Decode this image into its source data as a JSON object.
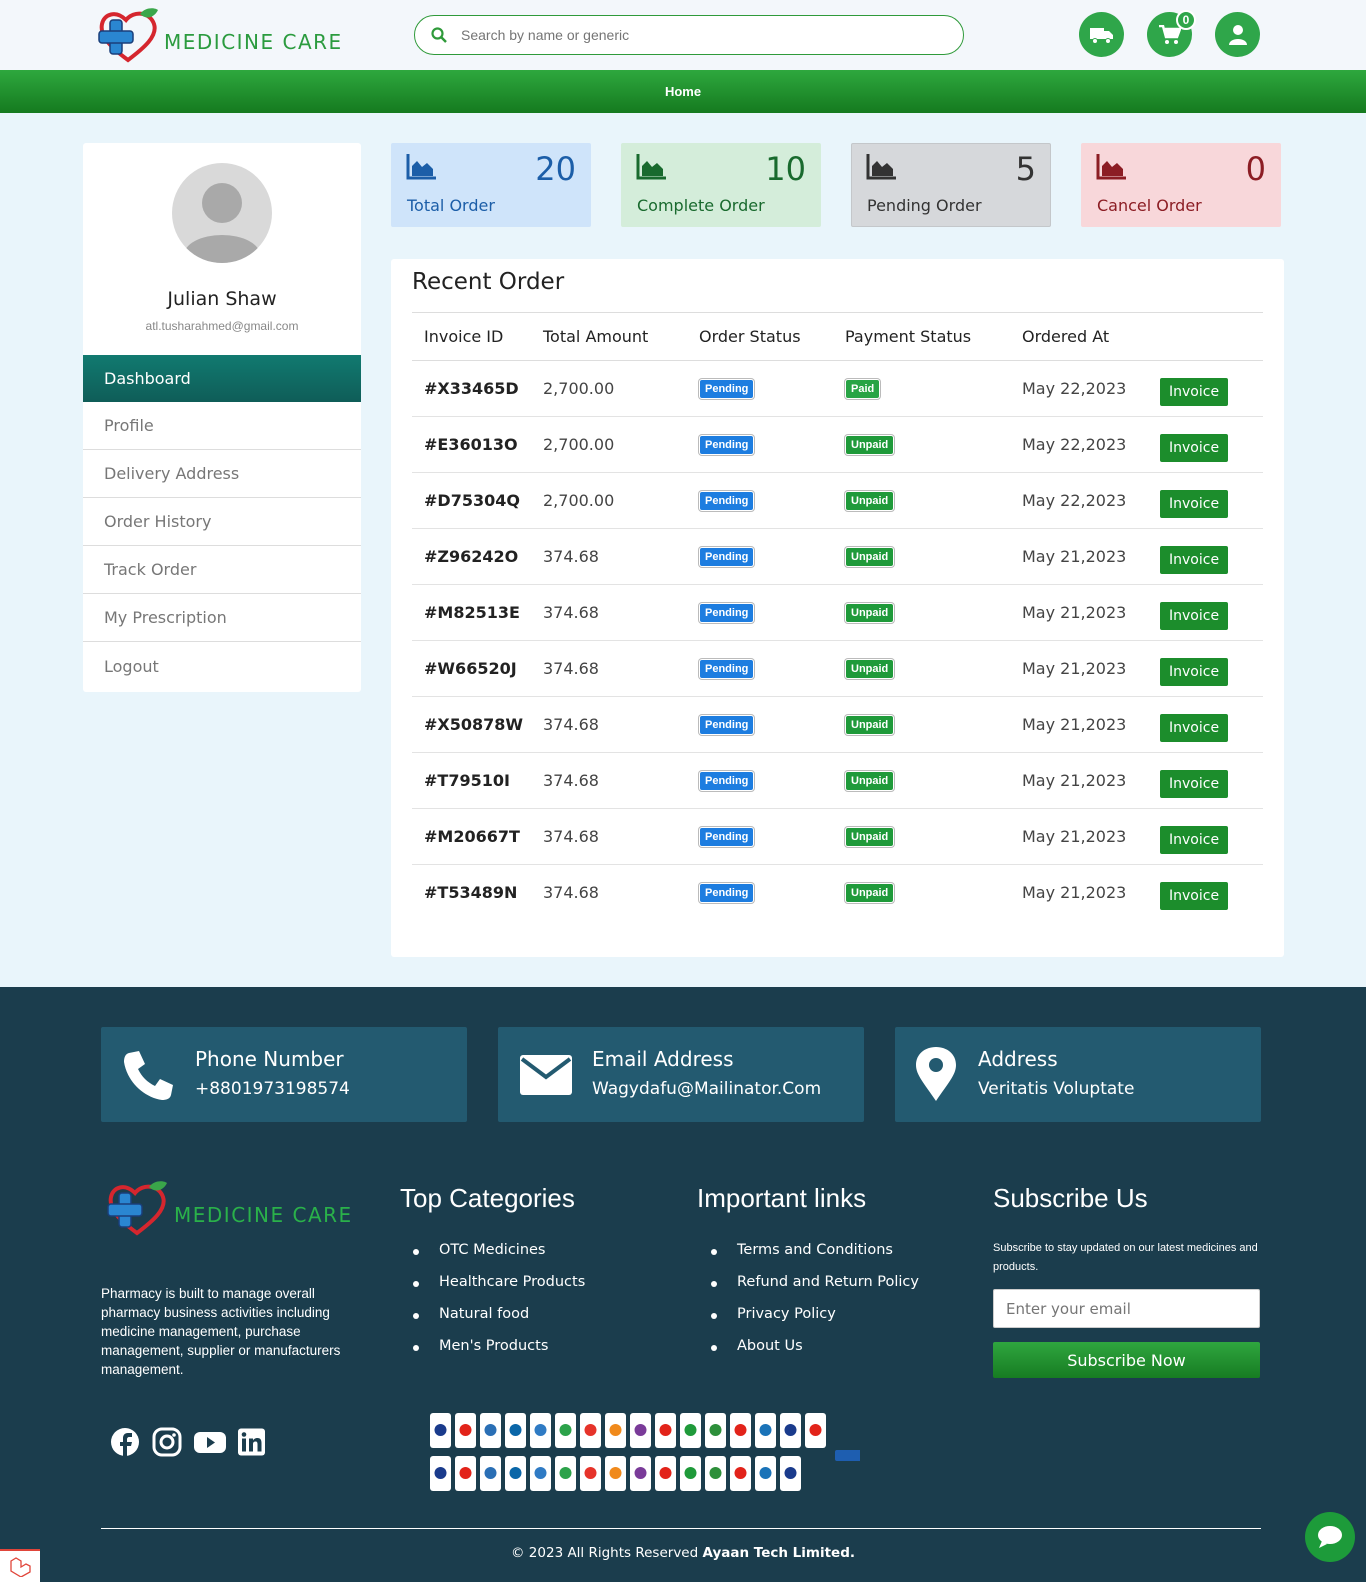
{
  "brand": {
    "name": "MEDICINE CARE"
  },
  "search": {
    "placeholder": "Search by name or generic"
  },
  "header": {
    "cart_count": "0"
  },
  "nav": {
    "home": "Home"
  },
  "user": {
    "name": "Julian Shaw",
    "email": "atl.tusharahmed@gmail.com"
  },
  "menu": [
    "Dashboard",
    "Profile",
    "Delivery Address",
    "Order History",
    "Track Order",
    "My Prescription",
    "Logout"
  ],
  "stats": [
    {
      "value": "20",
      "label": "Total Order",
      "color": "#1c5ea8",
      "bg": "#cfe4fa"
    },
    {
      "value": "10",
      "label": "Complete Order",
      "color": "#196a2e",
      "bg": "#d4edda"
    },
    {
      "value": "5",
      "label": "Pending Order",
      "color": "#333333",
      "bg": "#d6d8db"
    },
    {
      "value": "0",
      "label": "Cancel Order",
      "color": "#8c1d24",
      "bg": "#f8d7da"
    }
  ],
  "orders": {
    "title": "Recent Order",
    "columns": [
      "Invoice ID",
      "Total Amount",
      "Order Status",
      "Payment Status",
      "Ordered At"
    ],
    "button_label": "Invoice",
    "rows": [
      {
        "id": "#X33465D",
        "amount": "2,700.00",
        "status": "Pending",
        "payment": "Paid",
        "date": "May 22,2023"
      },
      {
        "id": "#E36013O",
        "amount": "2,700.00",
        "status": "Pending",
        "payment": "Unpaid",
        "date": "May 22,2023"
      },
      {
        "id": "#D75304Q",
        "amount": "2,700.00",
        "status": "Pending",
        "payment": "Unpaid",
        "date": "May 22,2023"
      },
      {
        "id": "#Z96242O",
        "amount": "374.68",
        "status": "Pending",
        "payment": "Unpaid",
        "date": "May 21,2023"
      },
      {
        "id": "#M82513E",
        "amount": "374.68",
        "status": "Pending",
        "payment": "Unpaid",
        "date": "May 21,2023"
      },
      {
        "id": "#W66520J",
        "amount": "374.68",
        "status": "Pending",
        "payment": "Unpaid",
        "date": "May 21,2023"
      },
      {
        "id": "#X50878W",
        "amount": "374.68",
        "status": "Pending",
        "payment": "Unpaid",
        "date": "May 21,2023"
      },
      {
        "id": "#T79510I",
        "amount": "374.68",
        "status": "Pending",
        "payment": "Unpaid",
        "date": "May 21,2023"
      },
      {
        "id": "#M20667T",
        "amount": "374.68",
        "status": "Pending",
        "payment": "Unpaid",
        "date": "May 21,2023"
      },
      {
        "id": "#T53489N",
        "amount": "374.68",
        "status": "Pending",
        "payment": "Unpaid",
        "date": "May 21,2023"
      }
    ]
  },
  "contact": {
    "phone_title": "Phone Number",
    "phone": "+8801973198574",
    "email_title": "Email Address",
    "email": "Wagydafu@Mailinator.Com",
    "address_title": "Address",
    "address": "Veritatis Voluptate"
  },
  "footer": {
    "description": "Pharmacy is built to manage overall pharmacy business activities including medicine management, purchase management, supplier or manufacturers management.",
    "categories_title": "Top Categories",
    "categories": [
      "OTC Medicines",
      "Healthcare Products",
      "Natural food",
      "Men's Products"
    ],
    "links_title": "Important links",
    "links": [
      "Terms and Conditions",
      "Refund and Return Policy",
      "Privacy Policy",
      "About Us"
    ],
    "subscribe_title": "Subscribe Us",
    "subscribe_text": "Subscribe to stay updated on our latest medicines and products.",
    "email_placeholder": "Enter your email",
    "subscribe_button": "Subscribe Now",
    "social_icons": [
      "facebook-icon",
      "instagram-icon",
      "youtube-icon",
      "linkedin-icon"
    ],
    "copyright_prefix": "2023 All Rights Reserved",
    "company": "Ayaan Tech Limited."
  }
}
